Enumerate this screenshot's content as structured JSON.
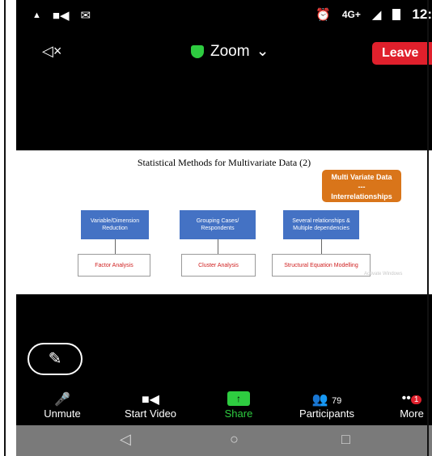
{
  "status": {
    "time": "12:",
    "network": "4G+",
    "left_icons": [
      "signal-icon",
      "video-icon",
      "mail-icon"
    ],
    "right_icons": [
      "alarm-icon",
      "signal-bars-icon",
      "battery-icon"
    ]
  },
  "meeting": {
    "title": "Zoom",
    "title_icon": "shield-check-icon",
    "leave_label": "Leave",
    "leave_color": "#e0202c",
    "speaker_icon": "speaker-muted-icon"
  },
  "slide": {
    "title": "Statistical Methods for Multivariate Data (2)",
    "highlight_box": {
      "line1": "Multi Variate  Data",
      "line2": "---",
      "line3": "Interrelationships"
    },
    "categories": [
      {
        "label": "Variable/Dimension\nReduction",
        "method": "Factor Analysis"
      },
      {
        "label": "Grouping Cases/\nRespondents",
        "method": "Cluster Analysis"
      },
      {
        "label": "Several relationships &\nMultiple dependencies",
        "method": "Structural Equation Modelling"
      }
    ],
    "watermark": "Activate Windows"
  },
  "annotate_icon": "pen-icon",
  "toolbar": {
    "unmute": "Unmute",
    "start_video": "Start Video",
    "share": "Share",
    "participants": "Participants",
    "participants_count": "79",
    "more": "More",
    "more_badge": "1",
    "share_color": "#2ecc40"
  },
  "navbar": {
    "back_icon": "back-triangle-icon",
    "home_icon": "home-circle-icon",
    "recents_icon": "recents-square-icon"
  }
}
